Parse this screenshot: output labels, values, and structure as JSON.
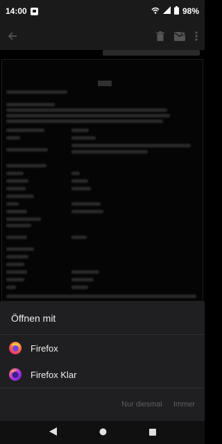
{
  "status_bar": {
    "time": "14:00",
    "battery": "98%",
    "icons": [
      "notification-icon",
      "wifi-calling-icon",
      "signal-icon",
      "battery-icon"
    ]
  },
  "toolbar": {
    "icons": [
      "back-arrow-icon",
      "trash-icon",
      "mark-unread-icon",
      "more-vert-icon"
    ]
  },
  "background_email": {
    "logo_alt": "logo"
  },
  "sheet": {
    "title": "Öffnen mit",
    "apps": [
      {
        "label": "Firefox",
        "icon": "firefox-icon"
      },
      {
        "label": "Firefox Klar",
        "icon": "firefox-focus-icon"
      }
    ],
    "actions": {
      "once": "Nur diesmal",
      "always": "Immer"
    }
  },
  "nav_bar": {
    "icons": [
      "nav-back-icon",
      "nav-home-icon",
      "nav-recents-icon"
    ]
  },
  "colors": {
    "sheet_bg": "#1f1f21",
    "disabled_text": "#5f5f62",
    "firefox_orange": "#ff7139",
    "firefox_focus_purple": "#8a3ee8"
  }
}
